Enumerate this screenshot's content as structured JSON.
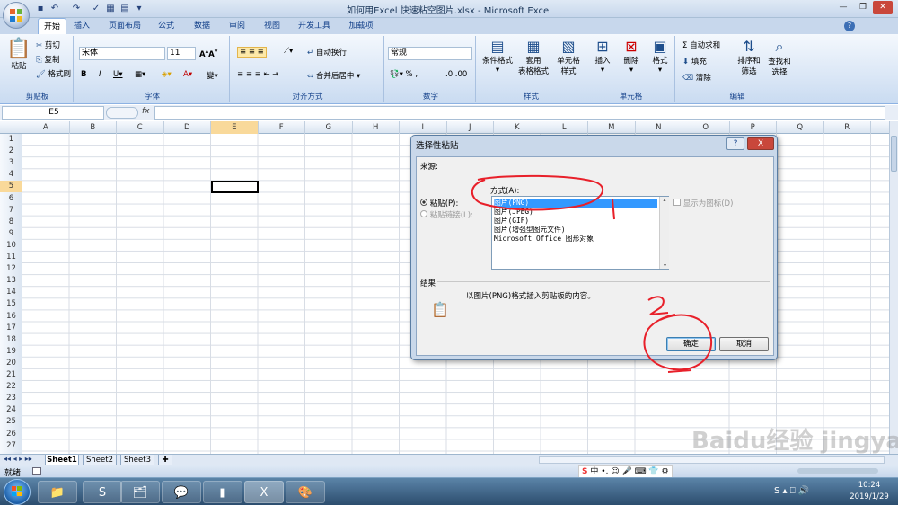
{
  "window": {
    "title": "如何用Excel 快速粘空图片.xlsx - Microsoft Excel"
  },
  "tabs": [
    "开始",
    "插入",
    "页面布局",
    "公式",
    "数据",
    "审阅",
    "视图",
    "开发工具",
    "加载项"
  ],
  "ribbon": {
    "clipboard": {
      "paste": "粘贴",
      "cut": "剪切",
      "copy": "复制",
      "format_painter": "格式刷",
      "label": "剪贴板"
    },
    "font": {
      "name": "宋体",
      "size": "11",
      "label": "字体"
    },
    "alignment": {
      "wrap": "自动换行",
      "merge": "合并后居中",
      "label": "对齐方式"
    },
    "number": {
      "format": "常规",
      "label": "数字"
    },
    "styles": {
      "cond": "条件格式",
      "table1": "套用",
      "table2": "表格格式",
      "cell1": "单元格",
      "cell2": "样式",
      "label": "样式"
    },
    "cells": {
      "insert": "插入",
      "delete": "删除",
      "format": "格式",
      "label": "单元格"
    },
    "editing": {
      "autosum": "Σ 自动求和",
      "fill": "填充",
      "clear": "清除",
      "sort1": "排序和",
      "sort2": "筛选",
      "find1": "查找和",
      "find2": "选择",
      "label": "编辑"
    }
  },
  "formula": {
    "namebox": "E5",
    "fx": "fx"
  },
  "columns": [
    "A",
    "B",
    "C",
    "D",
    "E",
    "F",
    "G",
    "H",
    "I",
    "J",
    "K",
    "L",
    "M",
    "N",
    "O",
    "P",
    "Q",
    "R"
  ],
  "rows": [
    "1",
    "2",
    "3",
    "4",
    "5",
    "6",
    "7",
    "8",
    "9",
    "10",
    "11",
    "12",
    "13",
    "14",
    "15",
    "16",
    "17",
    "18",
    "19",
    "20",
    "21",
    "22",
    "23",
    "24",
    "25",
    "26",
    "27"
  ],
  "sheets": [
    "Sheet1",
    "Sheet2",
    "Sheet3"
  ],
  "status": {
    "ready": "就绪"
  },
  "dialog": {
    "title": "选择性粘贴",
    "source": "来源:",
    "method": "方式(A):",
    "paste": "粘贴(P):",
    "paste_link": "粘贴链接(L):",
    "show_icon": "显示为图标(D)",
    "options": [
      "图片(PNG)",
      "图片(JPEG)",
      "图片(GIF)",
      "图片(增强型图元文件)",
      "Microsoft Office 图形对象"
    ],
    "result_label": "结果",
    "result_text": "以图片(PNG)格式插入剪贴板的内容。",
    "ok": "确定",
    "cancel": "取消",
    "help": "?",
    "close": "X"
  },
  "annotations": {
    "one": "1",
    "two": "2"
  },
  "taskbar": {
    "time": "10:24",
    "date": "2019/1/29",
    "ime": "中"
  },
  "watermark": "Baidu经验 jingyan.baidu.com"
}
